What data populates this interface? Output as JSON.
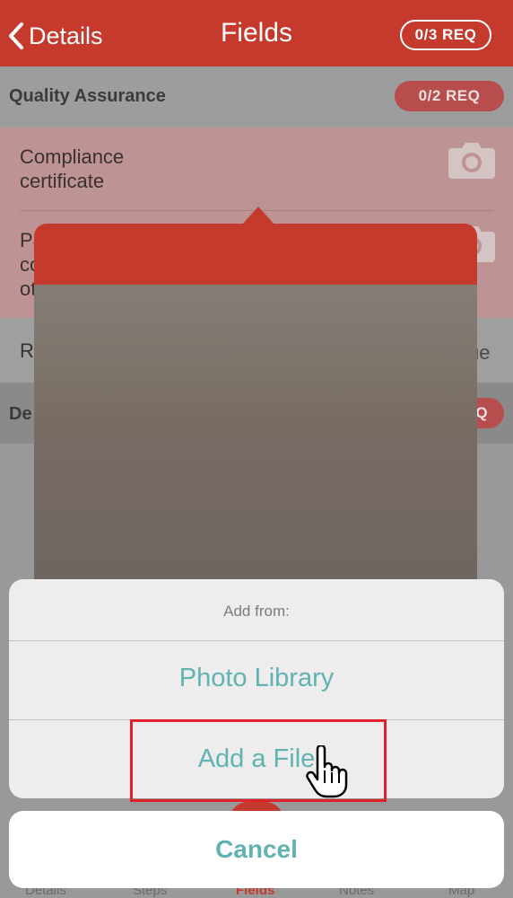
{
  "nav": {
    "back_label": "Details",
    "title": "Fields",
    "req_badge": "0/3 REQ"
  },
  "section1": {
    "title": "Quality Assurance",
    "req_badge": "0/2 REQ",
    "rows": [
      {
        "label_line1": "Compliance",
        "label_line2": "certificate",
        "icon": "camera-icon"
      },
      {
        "label_line1": "Pa",
        "label_line2": "co",
        "label_line3": "ot",
        "icon": "camera-icon"
      }
    ]
  },
  "row3": {
    "label": "Re",
    "value": "ue"
  },
  "section2": {
    "title": "De",
    "req_badge": "Q"
  },
  "action_sheet": {
    "title": "Add from:",
    "options": [
      "Photo Library",
      "Add a File"
    ],
    "cancel": "Cancel"
  },
  "tabbar": {
    "items": [
      "Details",
      "Steps",
      "Fields",
      "Notes",
      "Map"
    ],
    "active": "Fields"
  },
  "colors": {
    "brand_red": "#c53a2c",
    "action_teal": "#5fb3b3",
    "highlight_red": "#e0202a"
  }
}
